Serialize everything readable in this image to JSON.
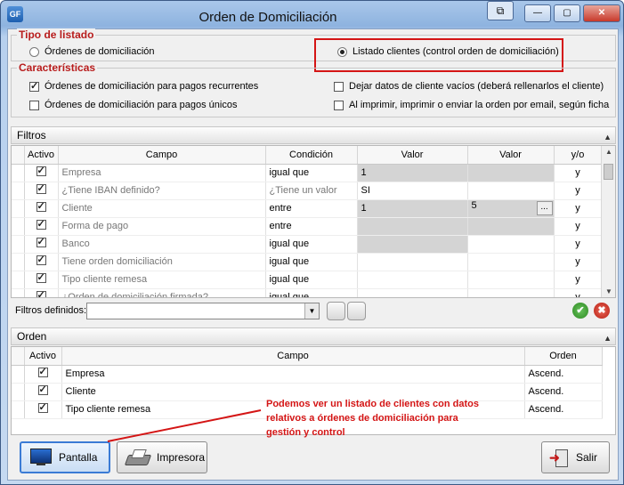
{
  "window": {
    "title": "Orden de Domiciliación",
    "app_icon_text": "GF",
    "buttons": {
      "minimize": "—",
      "maximize": "▢",
      "close": "✕"
    }
  },
  "tipo_listado": {
    "label": "Tipo de listado",
    "options": [
      {
        "label": "Órdenes de domiciliación",
        "selected": false
      },
      {
        "label": "Listado clientes (control orden de domiciliación)",
        "selected": true
      }
    ]
  },
  "caracteristicas": {
    "label": "Características",
    "checks": [
      {
        "label": "Órdenes de domiciliación para pagos recurrentes",
        "checked": true
      },
      {
        "label": "Órdenes de domiciliación para pagos únicos",
        "checked": false
      },
      {
        "label": "Dejar datos de cliente vacíos (deberá rellenarlos el cliente)",
        "checked": false
      },
      {
        "label": "Al imprimir, imprimir o enviar la orden por email, según ficha",
        "checked": false
      }
    ]
  },
  "filtros": {
    "label": "Filtros",
    "columns": [
      "Activo",
      "Campo",
      "Condición",
      "Valor",
      "Valor",
      "y/o"
    ],
    "rows": [
      {
        "activo": true,
        "campo": "Empresa",
        "condicion": "igual que",
        "valor1": "1",
        "valor2": "",
        "yo": "y"
      },
      {
        "activo": true,
        "campo": "¿Tiene IBAN definido?",
        "condicion": "¿Tiene un valor",
        "valor1": "SI",
        "valor2": "",
        "yo": "y"
      },
      {
        "activo": true,
        "campo": "Cliente",
        "condicion": "entre",
        "valor1": "1",
        "valor2": "5",
        "yo": "y"
      },
      {
        "activo": true,
        "campo": "Forma de pago",
        "condicion": "entre",
        "valor1": "",
        "valor2": "",
        "yo": "y"
      },
      {
        "activo": true,
        "campo": "Banco",
        "condicion": "igual que",
        "valor1": "",
        "valor2": "",
        "yo": "y"
      },
      {
        "activo": true,
        "campo": "Tiene orden domiciliación",
        "condicion": "igual que",
        "valor1": "",
        "valor2": "",
        "yo": "y"
      },
      {
        "activo": true,
        "campo": "Tipo cliente remesa",
        "condicion": "igual que",
        "valor1": "",
        "valor2": "",
        "yo": "y"
      },
      {
        "activo": true,
        "campo": "¿Orden de domiciliación firmada?",
        "condicion": "igual que",
        "valor1": "",
        "valor2": "",
        "yo": "y"
      }
    ],
    "ellipsis": "...",
    "defined_label": "Filtros definidos:",
    "defined_value": ""
  },
  "orden": {
    "label": "Orden",
    "columns": [
      "Activo",
      "Campo",
      "Orden"
    ],
    "rows": [
      {
        "activo": true,
        "campo": "Empresa",
        "orden": "Ascend."
      },
      {
        "activo": true,
        "campo": "Cliente",
        "orden": "Ascend."
      },
      {
        "activo": true,
        "campo": "Tipo cliente remesa",
        "orden": "Ascend."
      }
    ]
  },
  "annotation": "Podemos ver un listado de clientes con datos relativos a órdenes de domiciliación para gestión y control",
  "buttons": {
    "pantalla": "Pantalla",
    "impresora": "Impresora",
    "salir": "Salir"
  },
  "colors": {
    "group_label": "#b81d1d",
    "highlight": "#d41515",
    "annotation": "#d41515"
  }
}
